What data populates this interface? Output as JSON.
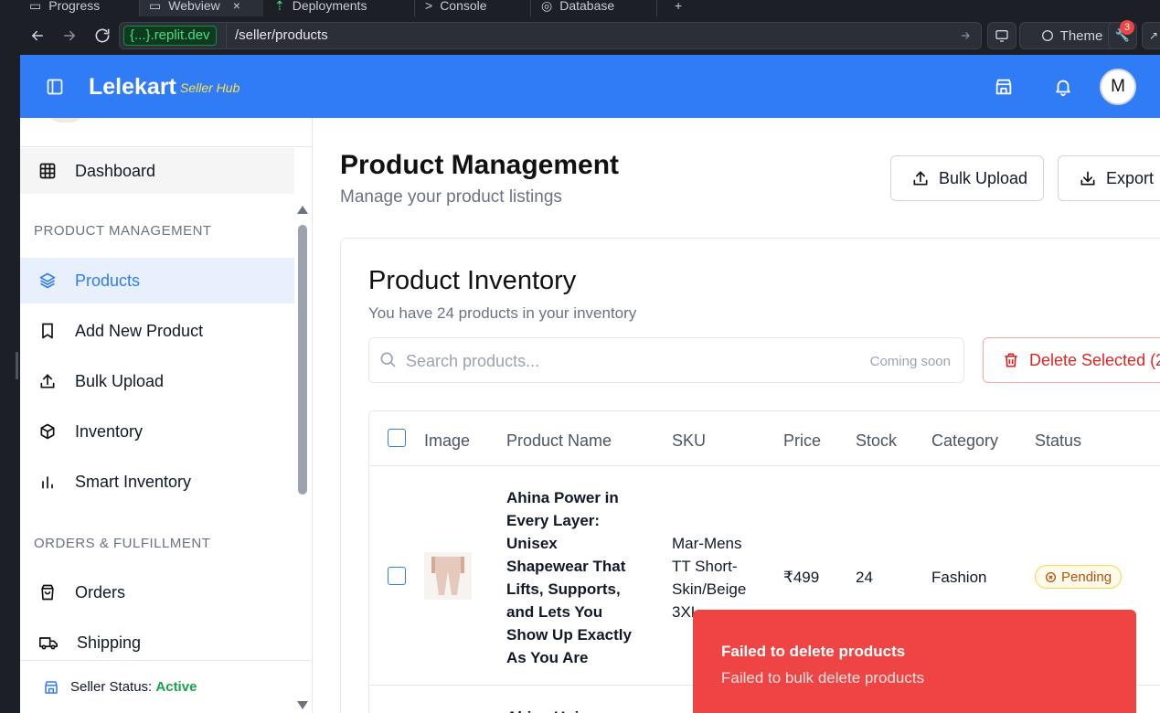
{
  "ide_tabs": [
    {
      "label": "Progress"
    },
    {
      "label": "Webview"
    },
    {
      "label": "Deployments"
    },
    {
      "label": "Console"
    },
    {
      "label": "Database"
    }
  ],
  "address_bar": {
    "domain": "{...}.replit.dev",
    "path": "/seller/products",
    "theme_label": "Theme",
    "notification_count": "3"
  },
  "header": {
    "brand": "Lelekart",
    "brand_sub": "Seller Hub",
    "avatar_initial": "M",
    "color": "#2f7cf6"
  },
  "sidebar": {
    "dashboard": "Dashboard",
    "section_product": "PRODUCT MANAGEMENT",
    "products": "Products",
    "add_new": "Add New Product",
    "bulk_upload": "Bulk Upload",
    "inventory": "Inventory",
    "smart_inventory": "Smart Inventory",
    "section_orders": "ORDERS & FULFILLMENT",
    "orders": "Orders",
    "shipping": "Shipping",
    "status_label": "Seller Status:",
    "status_value": "Active"
  },
  "page": {
    "title": "Product Management",
    "subtitle": "Manage your product listings",
    "bulk_upload_btn": "Bulk Upload",
    "export_btn": "Export"
  },
  "inventory": {
    "title": "Product Inventory",
    "subtitle": "You have 24 products in your inventory",
    "search_placeholder": "Search products...",
    "search_hint": "Coming soon",
    "delete_selected": "Delete Selected (2"
  },
  "table": {
    "headers": [
      "Image",
      "Product Name",
      "SKU",
      "Price",
      "Stock",
      "Category",
      "Status"
    ],
    "rows": [
      {
        "name_lines": [
          "Ahina Power in",
          "Every Layer:",
          "Unisex",
          "Shapewear That",
          "Lifts, Supports,",
          "and Lets You",
          "Show Up Exactly",
          "As You Are"
        ],
        "sku_lines": [
          "Mar-Mens",
          "TT Short-",
          "Skin/Beige",
          "3XL"
        ],
        "price": "₹499",
        "stock": "24",
        "category": "Fashion",
        "status": "Pending"
      }
    ],
    "next_row_partial": "Ahina Unis"
  },
  "toast": {
    "title": "Failed to delete products",
    "message": "Failed to bulk delete products",
    "color": "#ef4444"
  }
}
